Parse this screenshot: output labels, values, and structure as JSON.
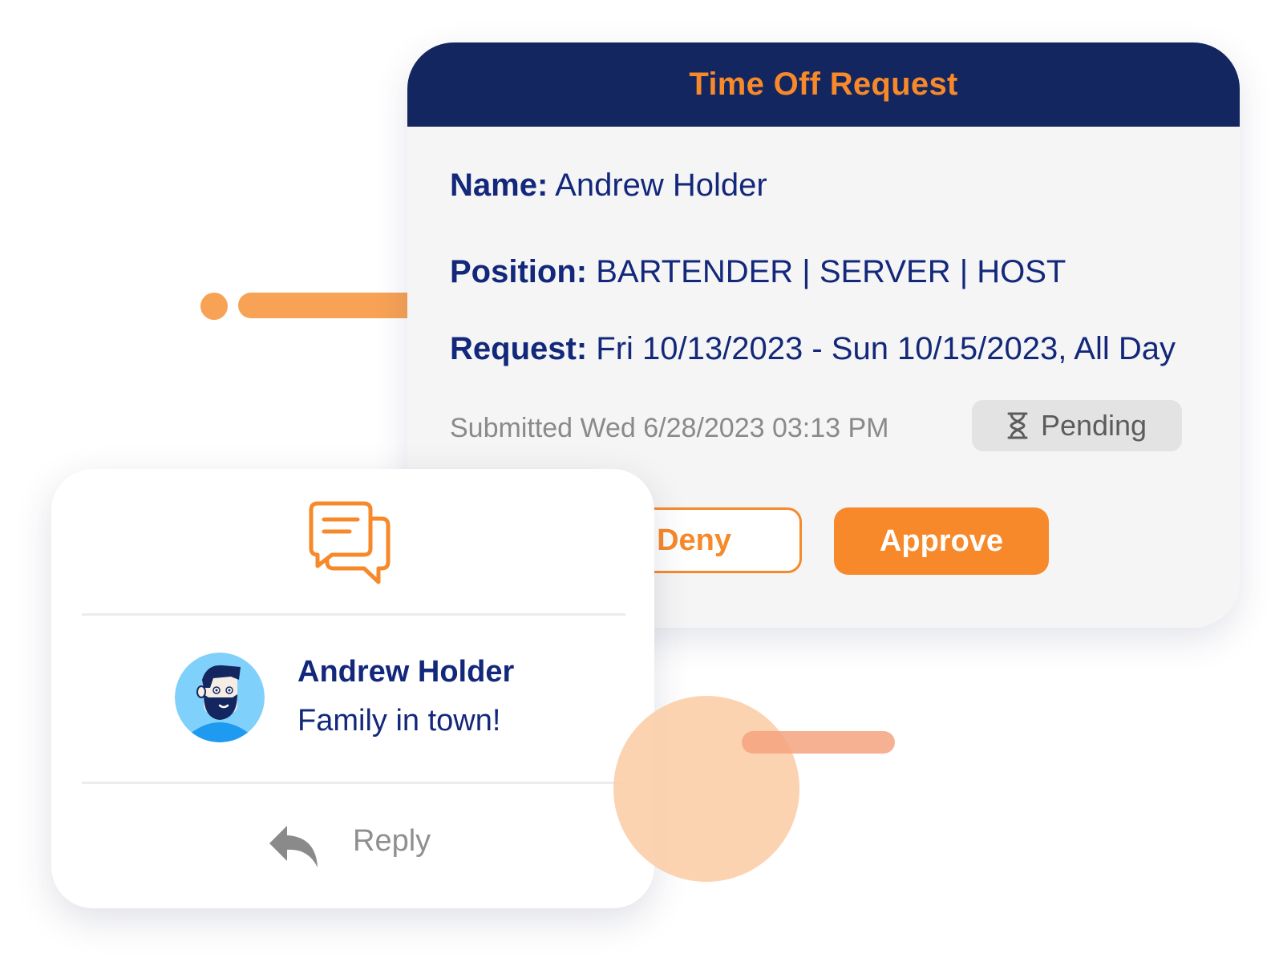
{
  "request": {
    "title": "Time Off Request",
    "name_label": "Name:",
    "name_value": "Andrew Holder",
    "position_label": "Position:",
    "position_value": "BARTENDER | SERVER | HOST",
    "request_label": "Request:",
    "request_value": "Fri 10/13/2023 - Sun 10/15/2023, All Day",
    "submitted": "Submitted Wed 6/28/2023 03:13 PM",
    "status": "Pending",
    "status_icon": "hourglass-icon",
    "deny_label": "Deny",
    "approve_label": "Approve"
  },
  "message": {
    "icon": "chat-bubbles-icon",
    "sender": "Andrew Holder",
    "text": "Family in town!",
    "reply_icon": "reply-arrow-icon",
    "reply_label": "Reply"
  },
  "colors": {
    "header_navy": "#13265f",
    "accent_orange": "#f7892a",
    "text_navy": "#13287a",
    "avatar_blue": "#1e9bf0"
  }
}
